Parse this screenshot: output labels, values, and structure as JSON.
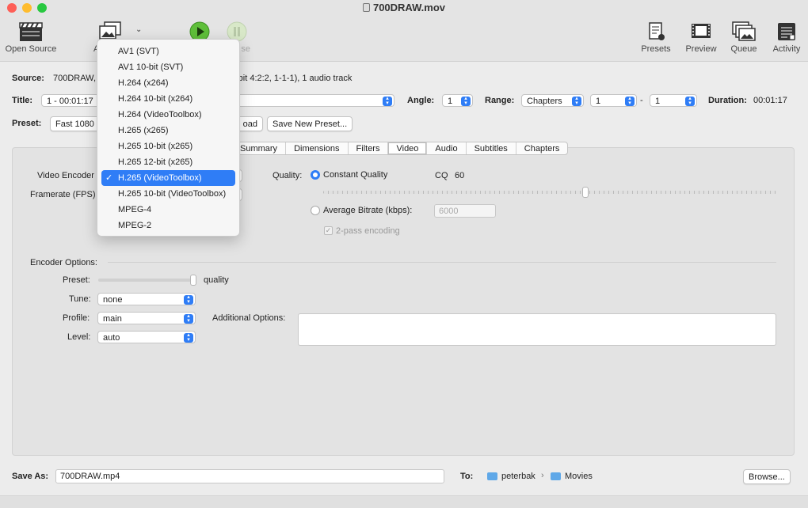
{
  "window": {
    "title": "700DRAW.mov"
  },
  "toolbar": {
    "open_source": "Open Source",
    "add_partial": "A",
    "start_partial": "",
    "pause_partial": "se",
    "presets": "Presets",
    "preview": "Preview",
    "queue": "Queue",
    "activity": "Activity"
  },
  "source": {
    "label": "Source:",
    "value": "700DRAW,",
    "value_tail": "-bit 4:2:2, 1-1-1), 1 audio track"
  },
  "title_row": {
    "label": "Title:",
    "value": "1 - 00:01:17",
    "angle_label": "Angle:",
    "angle": "1",
    "range_label": "Range:",
    "range_type": "Chapters",
    "range_from": "1",
    "range_dash": "-",
    "range_to": "1",
    "duration_label": "Duration:",
    "duration": "00:01:17"
  },
  "preset_row": {
    "label": "Preset:",
    "value": "Fast 1080",
    "reload_partial": "oad",
    "save_new": "Save New Preset..."
  },
  "tabs": [
    "Summary",
    "Dimensions",
    "Filters",
    "Video",
    "Audio",
    "Subtitles",
    "Chapters"
  ],
  "active_tab": "Video",
  "video": {
    "encoder_label": "Video Encoder",
    "framerate_label": "Framerate (FPS)",
    "quality_label": "Quality:",
    "constant_quality": "Constant Quality",
    "cq_label": "CQ",
    "cq_value": "60",
    "cq_slider_fraction": 0.58,
    "avg_bitrate": "Average Bitrate (kbps):",
    "bitrate_value": "6000",
    "two_pass": "2-pass encoding"
  },
  "encoder_options": {
    "heading": "Encoder Options:",
    "preset_label": "Preset:",
    "preset_value": "quality",
    "preset_slider_fraction": 1.0,
    "tune_label": "Tune:",
    "tune": "none",
    "profile_label": "Profile:",
    "profile": "main",
    "level_label": "Level:",
    "level": "auto",
    "additional_label": "Additional Options:",
    "additional_value": ""
  },
  "encoder_menu": {
    "items": [
      "AV1 (SVT)",
      "AV1 10-bit (SVT)",
      "H.264 (x264)",
      "H.264 10-bit (x264)",
      "H.264 (VideoToolbox)",
      "H.265 (x265)",
      "H.265 10-bit (x265)",
      "H.265 12-bit (x265)",
      "H.265 (VideoToolbox)",
      "H.265 10-bit (VideoToolbox)",
      "MPEG-4",
      "MPEG-2"
    ],
    "selected_index": 8,
    "check": "✓"
  },
  "save": {
    "label": "Save As:",
    "filename": "700DRAW.mp4",
    "to_label": "To:",
    "folder1": "peterbak",
    "sep": "›",
    "folder2": "Movies",
    "browse": "Browse..."
  },
  "colors": {
    "accent": "#2f7df6",
    "play_green": "#5fbf3a"
  }
}
